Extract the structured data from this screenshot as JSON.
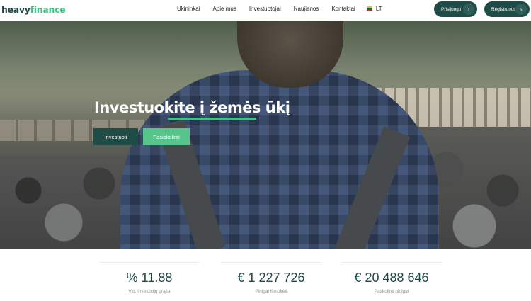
{
  "header": {
    "logo_heavy": "heavy",
    "logo_finance": "finance",
    "nav": [
      "Ūkininkai",
      "Apie mus",
      "Investuotojai",
      "Naujienos",
      "Kontaktai"
    ],
    "language": "LT",
    "login_label": "Prisijungti",
    "register_label": "Registruotis",
    "chevron": "›"
  },
  "hero": {
    "title": "Investuokite į žemės ūkį",
    "invest_label": "Investuoti",
    "borrow_label": "Pasiskolinti"
  },
  "stats": [
    {
      "value": "% 11.88",
      "label": "Vid. investicijų grąža"
    },
    {
      "value": "€ 1 227 726",
      "label": "Pinigai išmokėti"
    },
    {
      "value": "€ 20 488 646",
      "label": "Paskolinti pinigai"
    }
  ],
  "colors": {
    "primary": "#1f4c47",
    "accent": "#3ec28a",
    "borrow_button": "#56c58c"
  }
}
